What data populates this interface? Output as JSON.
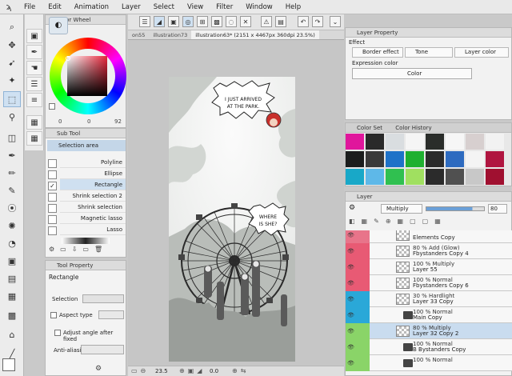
{
  "menu": {
    "items": [
      "File",
      "Edit",
      "Animation",
      "Layer",
      "Select",
      "View",
      "Filter",
      "Window",
      "Help"
    ]
  },
  "color_panel": {
    "title": "Color Wheel",
    "values": [
      "0",
      "0",
      "92"
    ],
    "main_color": "#e8263a"
  },
  "subtool_panel": {
    "title": "Sub Tool",
    "group": "Selection area",
    "items": [
      {
        "label": "Polyline",
        "selected": false
      },
      {
        "label": "Ellipse",
        "selected": false
      },
      {
        "label": "Rectangle",
        "selected": true
      },
      {
        "label": "Shrink selection 2",
        "selected": false
      },
      {
        "label": "Shrink selection",
        "selected": false
      },
      {
        "label": "Magnetic lasso",
        "selected": false
      },
      {
        "label": "Lasso",
        "selected": false
      }
    ]
  },
  "tool_property": {
    "title": "Tool Property",
    "tool_name": "Rectangle",
    "rows": [
      "Selection",
      "Aspect type",
      "Adjust angle after fixed",
      "Anti-aliasing"
    ]
  },
  "canvas": {
    "tabs": [
      "on55",
      "illustration73",
      "illustration63* (2151 x 4467px 360dpi 23.5%)"
    ],
    "bubble1": [
      "I JUST ARRIVED",
      "AT THE PARK."
    ],
    "bubble2": [
      "WHERE",
      "IS SHE?"
    ],
    "zoom": "23.5",
    "rotation": "0.0"
  },
  "layer_property": {
    "title": "Layer Property",
    "effect_label": "Effect",
    "effects": [
      "Border effect",
      "Tone",
      "Layer color"
    ],
    "expression_label": "Expression color",
    "expression_value": "Color"
  },
  "color_set": {
    "tabs": [
      "Color Set",
      "Color History"
    ],
    "swatches": [
      "#e0169c",
      "#2a2a2a",
      "#d9dde0",
      "#f5f5f5",
      "#2a2d2a",
      "#f6f6f6",
      "#d7cfcf",
      "#f2f2f2",
      "#1b1d1d",
      "#3a3a3a",
      "#1e72c8",
      "#1fb030",
      "#2b2b2b",
      "#2e6bc0",
      "#f4f4f4",
      "#b01540",
      "#18a8c8",
      "#5eb8e8",
      "#30c050",
      "#a0e060",
      "#2b2b2b",
      "#505050",
      "#c8c8c8",
      "#a01030"
    ]
  },
  "layer_panel": {
    "title": "Layer",
    "blend_mode": "Multiply",
    "opacity": "80",
    "layers": [
      {
        "mode": "",
        "name": "Elements Copy",
        "strip": "#e8748a",
        "type": "layer"
      },
      {
        "mode": "80 % Add (Glow)",
        "name": "Fbystanders Copy 4",
        "strip": "#e85a74",
        "type": "layer"
      },
      {
        "mode": "100 % Multiply",
        "name": "Layer 55",
        "strip": "#e85a74",
        "type": "layer"
      },
      {
        "mode": "100 % Normal",
        "name": "Fbystanders Copy 6",
        "strip": "#e85a74",
        "type": "layer"
      },
      {
        "mode": "30 % Hardlight",
        "name": "Layer 33 Copy",
        "strip": "#2aa8d8",
        "type": "layer"
      },
      {
        "mode": "100 % Normal",
        "name": "Main Copy",
        "strip": "#2aa8d8",
        "type": "folder"
      },
      {
        "mode": "80 % Multiply",
        "name": "Layer 32 Copy 2",
        "strip": "#8ad468",
        "type": "layer",
        "selected": true
      },
      {
        "mode": "100 % Normal",
        "name": "B Bystanders Copy",
        "strip": "#8ad468",
        "type": "folder"
      },
      {
        "mode": "100 % Normal",
        "name": "",
        "strip": "#8ad468",
        "type": "folder"
      }
    ]
  }
}
